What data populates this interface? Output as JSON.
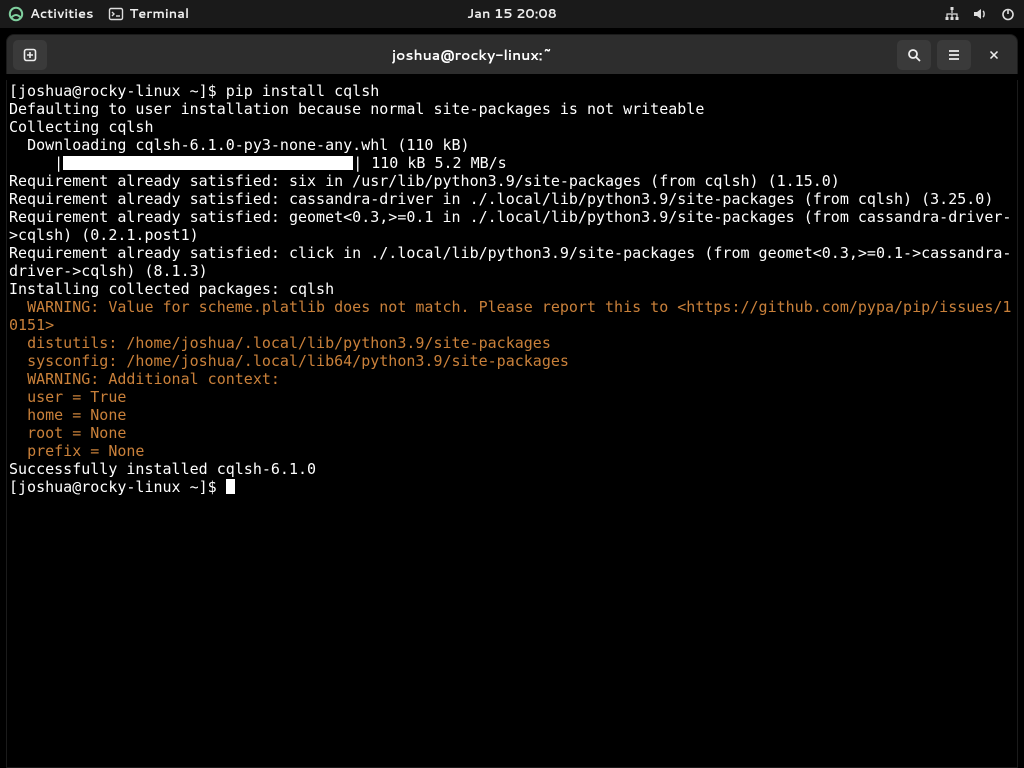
{
  "topbar": {
    "activities": "Activities",
    "app_label": "Terminal",
    "clock": "Jan 15  20:08"
  },
  "window": {
    "title": "joshua@rocky-linux:~"
  },
  "term": {
    "prompt": "[joshua@rocky-linux ~]$ ",
    "cmd": "pip install cqlsh",
    "l2": "Defaulting to user installation because normal site-packages is not writeable",
    "l3": "Collecting cqlsh",
    "l4": "  Downloading cqlsh-6.1.0-py3-none-any.whl (110 kB)",
    "l5_prefix": "     |",
    "l5_suffix": "| 110 kB 5.2 MB/s",
    "l6": "Requirement already satisfied: six in /usr/lib/python3.9/site-packages (from cqlsh) (1.15.0)",
    "l7": "Requirement already satisfied: cassandra-driver in ./.local/lib/python3.9/site-packages (from cqlsh) (3.25.0)",
    "l8": "Requirement already satisfied: geomet<0.3,>=0.1 in ./.local/lib/python3.9/site-packages (from cassandra-driver->cqlsh) (0.2.1.post1)",
    "l9": "Requirement already satisfied: click in ./.local/lib/python3.9/site-packages (from geomet<0.3,>=0.1->cassandra-driver->cqlsh) (8.1.3)",
    "l10": "Installing collected packages: cqlsh",
    "w1": "  WARNING: Value for scheme.platlib does not match. Please report this to <https://github.com/pypa/pip/issues/10151>",
    "w2": "  distutils: /home/joshua/.local/lib/python3.9/site-packages",
    "w3": "  sysconfig: /home/joshua/.local/lib64/python3.9/site-packages",
    "w4": "  WARNING: Additional context:",
    "w5": "  user = True",
    "w6": "  home = None",
    "w7": "  root = None",
    "w8": "  prefix = None",
    "l11": "Successfully installed cqlsh-6.1.0",
    "prompt2": "[joshua@rocky-linux ~]$ "
  }
}
